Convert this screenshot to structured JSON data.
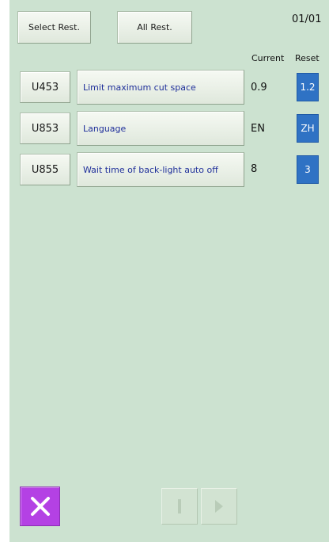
{
  "header": {
    "select_rest_label": "Select Rest.",
    "all_rest_label": "All Rest.",
    "page_indicator": "01/01"
  },
  "columns": {
    "current_label": "Current",
    "reset_label": "Reset"
  },
  "rows": [
    {
      "code": "U453",
      "description": "Limit maximum cut space",
      "current": "0.9",
      "reset": "1.2"
    },
    {
      "code": "U853",
      "description": "Language",
      "current": "EN",
      "reset": "ZH"
    },
    {
      "code": "U855",
      "description": "Wait time of back-light auto off",
      "current": "8",
      "reset": "3"
    }
  ],
  "footer": {
    "close_icon": "close-x-icon",
    "prev_icon": "prev-page-icon",
    "next_icon": "next-page-icon"
  },
  "colors": {
    "background": "#cce2d0",
    "reset_blue": "#2f72c4",
    "close_purple": "#b441e4",
    "description_text": "#1f2f9a"
  }
}
